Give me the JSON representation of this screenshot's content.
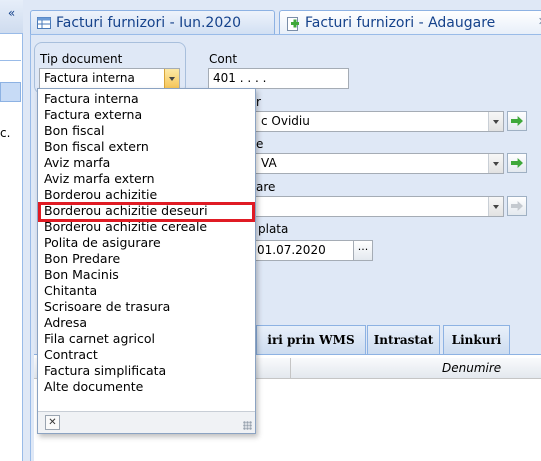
{
  "left_panel": {
    "collapse_glyph": "«",
    "partial_text": "c."
  },
  "tabs": [
    {
      "label": "Facturi furnizori - Iun.2020"
    },
    {
      "label": "Facturi furnizori - Adaugare",
      "close_glyph": "✕"
    }
  ],
  "form": {
    "tip_document": {
      "label": "Tip document",
      "value": "Factura interna"
    },
    "cont": {
      "label": "Cont",
      "value": "401 .  .  .  ."
    },
    "field2": {
      "label_partial": "r",
      "value_partial": "c Ovidiu"
    },
    "field3": {
      "label_partial": "e",
      "value_partial": "VA"
    },
    "field4": {
      "label_partial": "are",
      "value": ""
    },
    "data_plata": {
      "label_partial": "plata",
      "value": "01.07.2020",
      "button_glyph": "···"
    }
  },
  "bottom_tabs": [
    {
      "label": "iri prin WMS"
    },
    {
      "label": "Intrastat"
    },
    {
      "label": "Linkuri"
    }
  ],
  "grid": {
    "column": "Denumire"
  },
  "dropdown": {
    "items": [
      "Factura interna",
      "Factura externa",
      "Bon fiscal",
      "Bon fiscal extern",
      "Aviz marfa",
      "Aviz marfa extern",
      "Borderou achizitie",
      "Borderou achizitie deseuri",
      "Borderou achizitie cereale",
      "Polita de asigurare",
      "Bon Predare",
      "Bon Macinis",
      "Chitanta",
      "Scrisoare de trasura",
      "Adresa",
      "Fila carnet agricol",
      "Contract",
      "Factura simplificata",
      "Alte documente"
    ],
    "highlighted_item": "Borderou achizitie deseuri",
    "close_glyph": "✕"
  },
  "colors": {
    "panel_bg": "#dfe8f6",
    "tab_text": "#15428b",
    "highlight_border": "#e01b24",
    "go_arrow": "#3fa83a"
  }
}
